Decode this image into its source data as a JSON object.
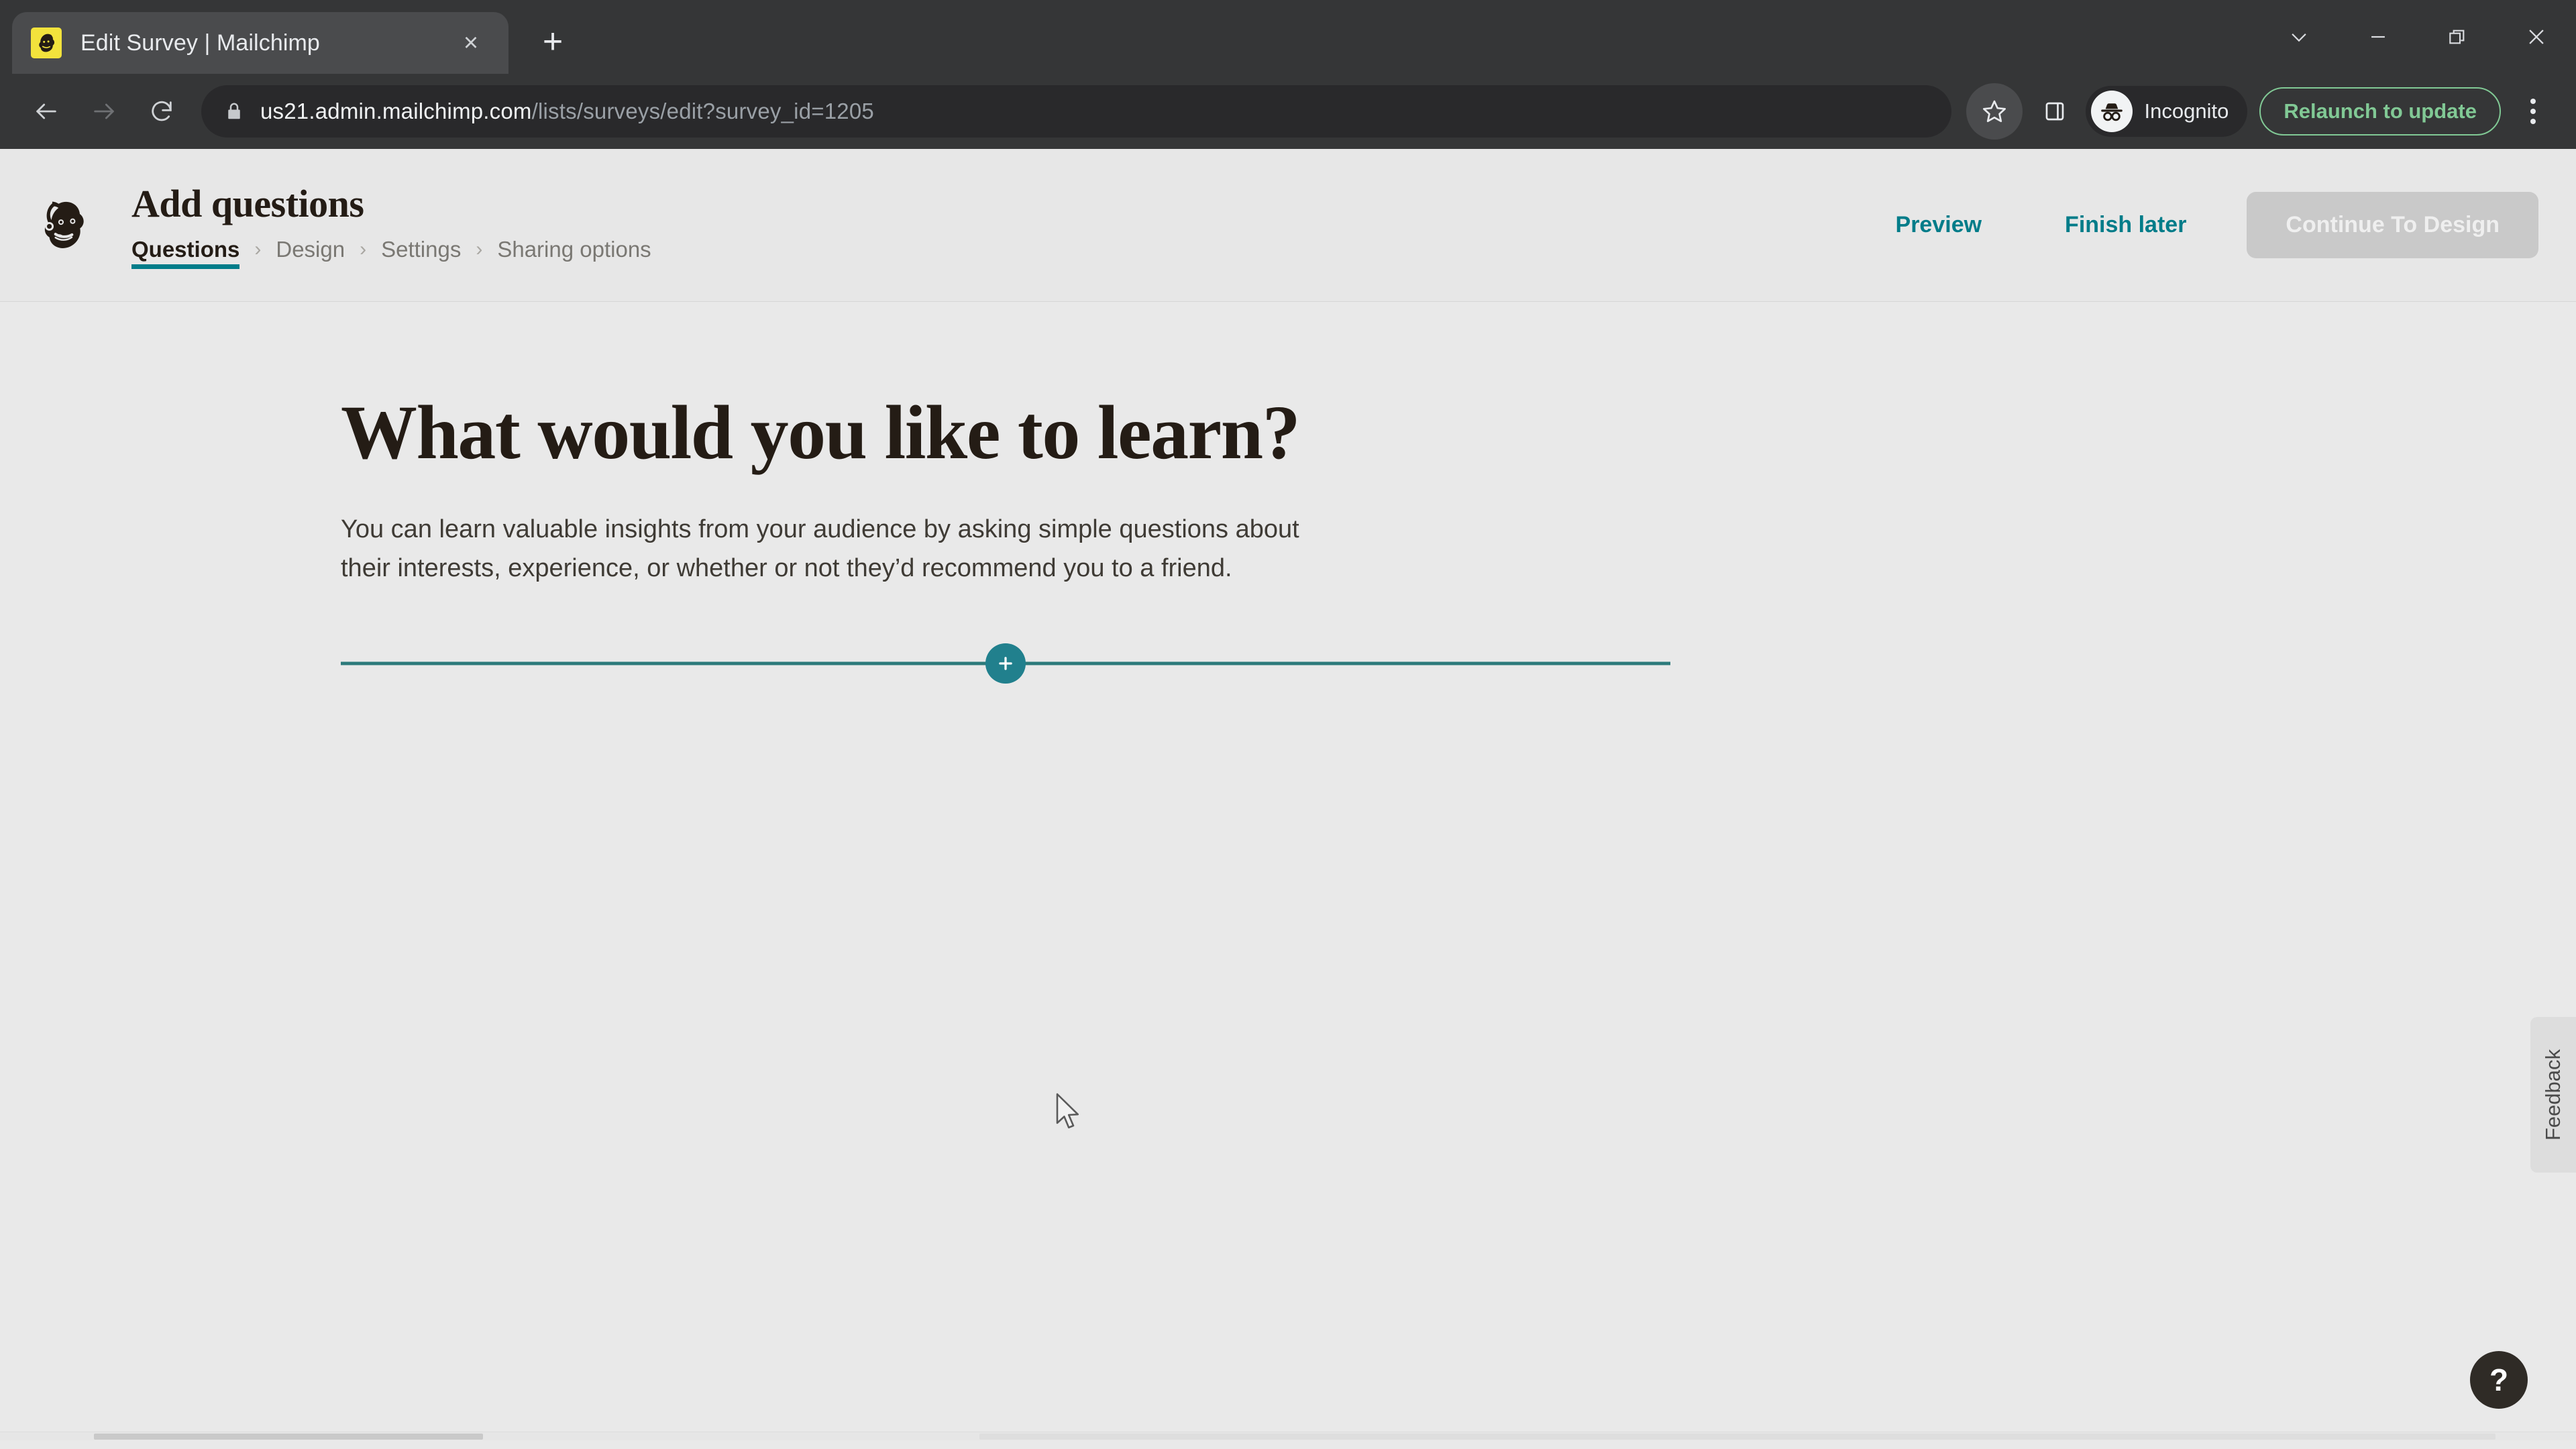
{
  "browser": {
    "tab": {
      "title": "Edit Survey | Mailchimp",
      "favicon": "mailchimp-favicon",
      "close_label": "×"
    },
    "new_tab_label": "+",
    "window_controls": [
      "chevron-down",
      "minimize",
      "restore",
      "close"
    ],
    "nav": {
      "back": "back-arrow",
      "forward": "forward-arrow",
      "reload": "reload-icon"
    },
    "omnibox": {
      "lock": "lock-icon",
      "host": "us21.admin.mailchimp.com",
      "path": "/lists/surveys/edit?survey_id=1205",
      "full_url": "us21.admin.mailchimp.com/lists/surveys/edit?survey_id=1205"
    },
    "bookmark_label": "star-icon",
    "side_panel_label": "side-panel-icon",
    "profile": {
      "label": "Incognito",
      "avatar": "incognito-avatar"
    },
    "update_button": "Relaunch to update",
    "menu_label": "browser-menu"
  },
  "app": {
    "logo": "mailchimp-freddie-logo",
    "title": "Add questions",
    "breadcrumbs": [
      {
        "label": "Questions",
        "active": true
      },
      {
        "label": "Design",
        "active": false
      },
      {
        "label": "Settings",
        "active": false
      },
      {
        "label": "Sharing options",
        "active": false
      }
    ],
    "separator": "›",
    "actions": {
      "preview": "Preview",
      "finish_later": "Finish later",
      "continue": "Continue To Design"
    }
  },
  "main": {
    "heading": "What would you like to learn?",
    "description": "You can learn valuable insights from your audience by asking simple questions about their interests, experience, or whether or not they’d recommend you to a friend.",
    "add_question_label": "+"
  },
  "widgets": {
    "feedback_label": "Feedback",
    "help_label": "?"
  },
  "colors": {
    "teal": "#007c89",
    "add_button": "#21808d",
    "divider": "#2c7a7b",
    "page_bg": "#e9e9e9",
    "chrome_bg": "#353637",
    "update_green": "#81c995",
    "favicon_yellow": "#f2e23c",
    "heading": "#241c15"
  }
}
